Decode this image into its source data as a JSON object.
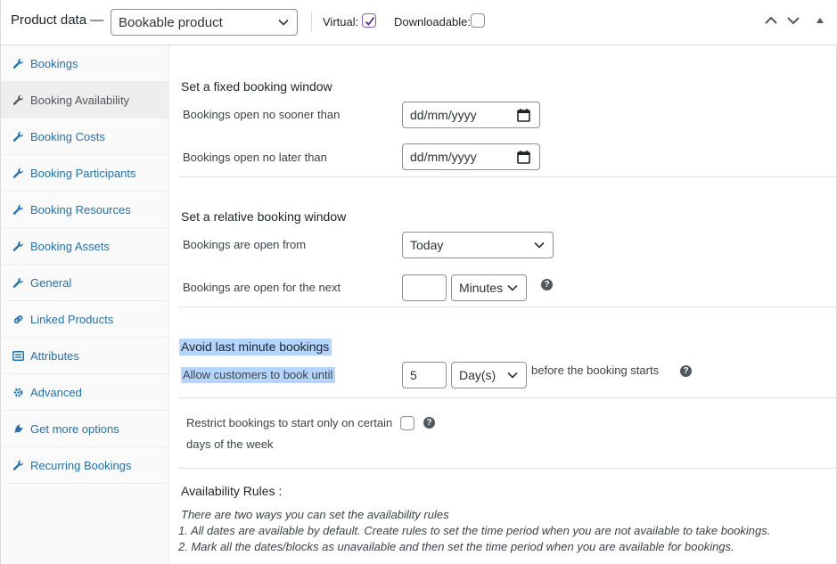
{
  "header": {
    "title": "Product data —",
    "product_type": "Bookable product",
    "virtual_label": "Virtual:",
    "virtual_checked": true,
    "downloadable_label": "Downloadable:",
    "downloadable_checked": false
  },
  "sidebar": {
    "items": [
      {
        "label": "Bookings",
        "icon": "wrench-icon",
        "active": false
      },
      {
        "label": "Booking Availability",
        "icon": "wrench-icon",
        "active": true
      },
      {
        "label": "Booking Costs",
        "icon": "wrench-icon",
        "active": false
      },
      {
        "label": "Booking Participants",
        "icon": "wrench-icon",
        "active": false
      },
      {
        "label": "Booking Resources",
        "icon": "wrench-icon",
        "active": false
      },
      {
        "label": "Booking Assets",
        "icon": "wrench-icon",
        "active": false
      },
      {
        "label": "General",
        "icon": "wrench-icon",
        "active": false
      },
      {
        "label": "Linked Products",
        "icon": "link-icon",
        "active": false
      },
      {
        "label": "Attributes",
        "icon": "list-icon",
        "active": false
      },
      {
        "label": "Advanced",
        "icon": "gear-icon",
        "active": false
      },
      {
        "label": "Get more options",
        "icon": "plug-icon",
        "active": false
      },
      {
        "label": "Recurring Bookings",
        "icon": "wrench-icon",
        "active": false
      }
    ]
  },
  "fixed": {
    "title": "Set a fixed booking window",
    "open_label": "Bookings open no sooner than",
    "open_value": "dd/mm/yyyy",
    "close_label": "Bookings open no later than",
    "close_value": "dd/mm/yyyy"
  },
  "relative": {
    "title": "Set a relative booking window",
    "from_label": "Bookings are open from",
    "from_value": "Today",
    "next_label": "Bookings are open for the next",
    "next_value": "",
    "next_unit": "Minutes"
  },
  "last_minute": {
    "title": "Avoid last minute bookings",
    "until_label": "Allow customers to book until",
    "until_value": "5",
    "until_unit": "Day(s)",
    "suffix": "before the booking starts"
  },
  "restrict": {
    "label_line1": "Restrict bookings to start only on certain",
    "label_line2": "days of the week",
    "checked": false
  },
  "rules": {
    "title": "Availability Rules :",
    "intro": "There are two ways you can set the availability rules",
    "line1": "1. All dates are available by default. Create rules to set the time period when you are not available to take bookings.",
    "line2": "2. Mark all the dates/blocks as unavailable and then set the time period when you are available for bookings."
  },
  "colors": {
    "link": "#2271b1",
    "highlight": "#b4d5fe",
    "checkbox_accent": "#7e5bd9"
  }
}
